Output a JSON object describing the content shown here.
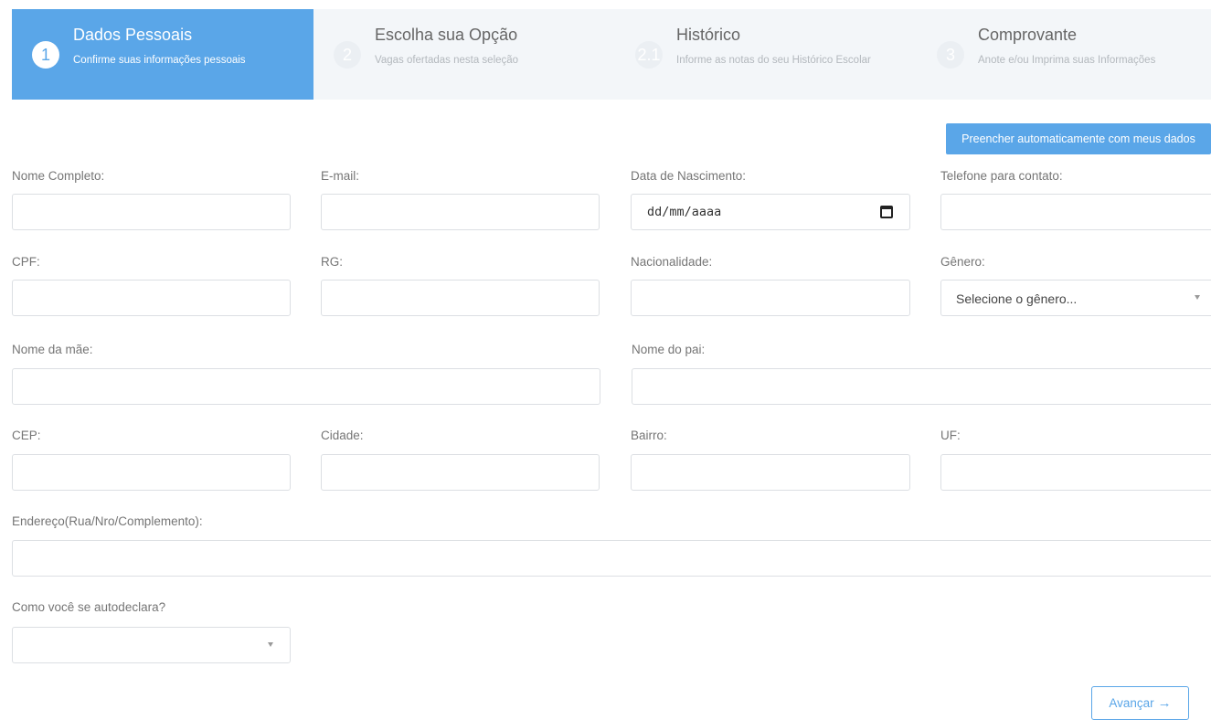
{
  "stepper": {
    "steps": [
      {
        "number": "1",
        "title": "Dados Pessoais",
        "subtitle": "Confirme suas informações pessoais",
        "active": true
      },
      {
        "number": "2",
        "title": "Escolha sua Opção",
        "subtitle": "Vagas ofertadas nesta seleção",
        "active": false
      },
      {
        "number": "2.1",
        "title": "Histórico",
        "subtitle": "Informe as notas do seu Histórico Escolar",
        "active": false
      },
      {
        "number": "3",
        "title": "Comprovante",
        "subtitle": "Anote e/ou Imprima suas Informações",
        "active": false
      }
    ]
  },
  "autofill_button": {
    "label": "Preencher automaticamente com meus dados"
  },
  "form": {
    "nome_completo": {
      "label": "Nome Completo:",
      "value": ""
    },
    "email": {
      "label": "E-mail:",
      "value": ""
    },
    "data_nascimento": {
      "label": "Data de Nascimento:",
      "placeholder": "dd/mm/aaaa"
    },
    "telefone": {
      "label": "Telefone para contato:",
      "value": ""
    },
    "cpf": {
      "label": "CPF:",
      "value": ""
    },
    "rg": {
      "label": "RG:",
      "value": ""
    },
    "nacionalidade": {
      "label": "Nacionalidade:",
      "value": ""
    },
    "genero": {
      "label": "Gênero:",
      "selected": "Selecione o gênero..."
    },
    "nome_mae": {
      "label": "Nome da mãe:",
      "value": ""
    },
    "nome_pai": {
      "label": "Nome do pai:",
      "value": ""
    },
    "cep": {
      "label": "CEP:",
      "value": ""
    },
    "cidade": {
      "label": "Cidade:",
      "value": ""
    },
    "bairro": {
      "label": "Bairro:",
      "value": ""
    },
    "uf": {
      "label": "UF:",
      "value": ""
    },
    "endereco": {
      "label": "Endereço(Rua/Nro/Complemento):",
      "value": ""
    },
    "autodeclara": {
      "label": "Como você se autodeclara?",
      "selected": ""
    }
  },
  "next_button": {
    "label": "Avançar",
    "icon": "→"
  },
  "colors": {
    "accent": "#5aa6e8",
    "stepper_background": "#f3f6f9",
    "field_border": "#dcdfe3",
    "label_text": "#757575"
  }
}
